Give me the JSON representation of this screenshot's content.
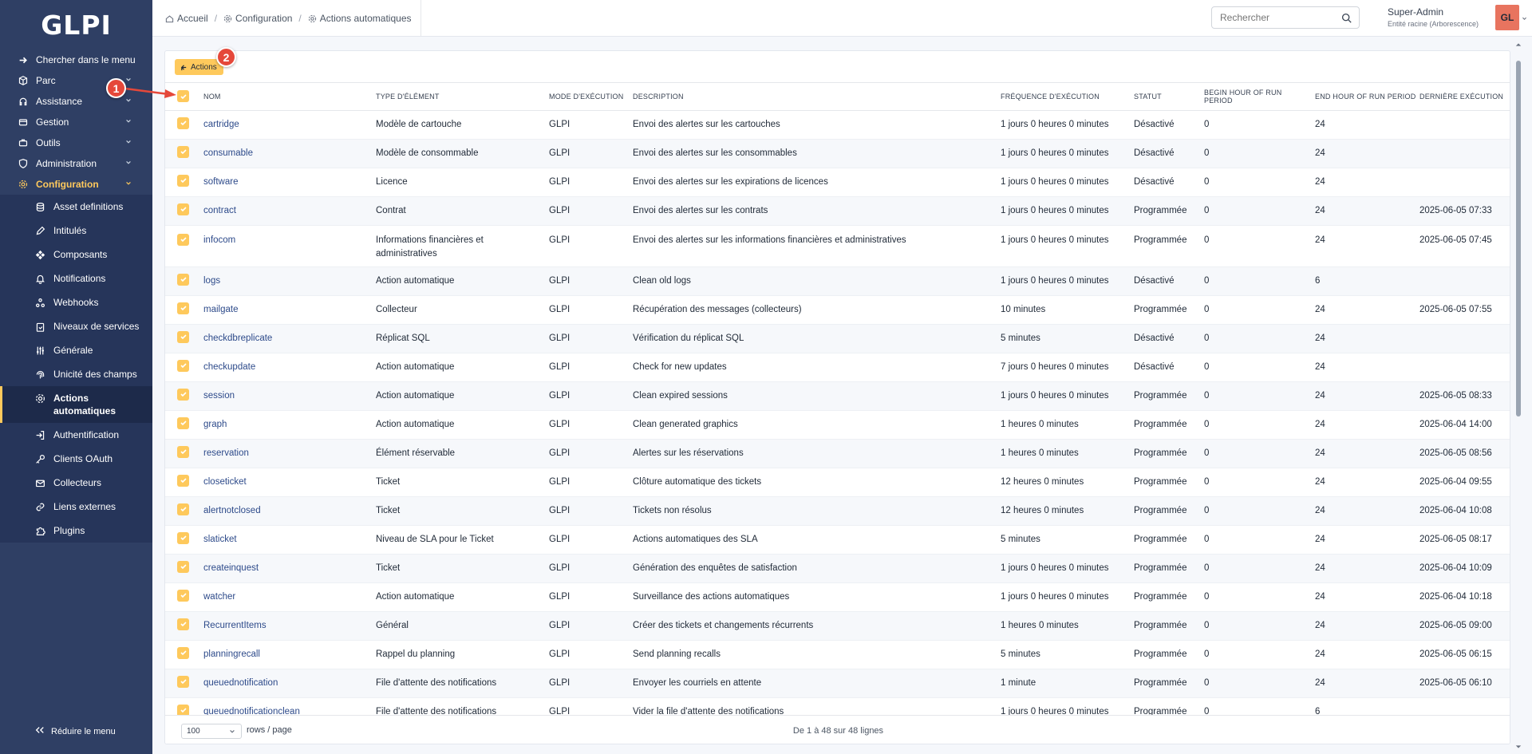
{
  "sidebar": {
    "logo": "GLPI",
    "search_menu": "Chercher dans le menu",
    "items": [
      {
        "label": "Parc"
      },
      {
        "label": "Assistance"
      },
      {
        "label": "Gestion"
      },
      {
        "label": "Outils"
      },
      {
        "label": "Administration"
      },
      {
        "label": "Configuration"
      }
    ],
    "subitems": [
      {
        "label": "Asset definitions"
      },
      {
        "label": "Intitulés"
      },
      {
        "label": "Composants"
      },
      {
        "label": "Notifications"
      },
      {
        "label": "Webhooks"
      },
      {
        "label": "Niveaux de services"
      },
      {
        "label": "Générale"
      },
      {
        "label": "Unicité des champs"
      },
      {
        "label": "Actions automatiques"
      },
      {
        "label": "Authentification"
      },
      {
        "label": "Clients OAuth"
      },
      {
        "label": "Collecteurs"
      },
      {
        "label": "Liens externes"
      },
      {
        "label": "Plugins"
      }
    ],
    "collapse_label": "Réduire le menu"
  },
  "header": {
    "breadcrumb": [
      "Accueil",
      "Configuration",
      "Actions automatiques"
    ],
    "search_placeholder": "Rechercher",
    "user_name": "Super-Admin",
    "user_entity": "Entité racine (Arborescence)",
    "avatar_initials": "GL"
  },
  "toolbar": {
    "actions_label": "Actions"
  },
  "annotations": {
    "badge1": "1",
    "badge2": "2"
  },
  "table": {
    "columns": [
      "NOM",
      "TYPE D'ÉLÉMENT",
      "MODE D'EXÉCUTION",
      "DESCRIPTION",
      "FRÉQUENCE D'EXÉCUTION",
      "STATUT",
      "BEGIN HOUR OF RUN PERIOD",
      "END HOUR OF RUN PERIOD",
      "DERNIÈRE EXÉCUTION"
    ],
    "rows": [
      [
        "cartridge",
        "Modèle de cartouche",
        "GLPI",
        "Envoi des alertes sur les cartouches",
        "1 jours 0 heures 0 minutes",
        "Désactivé",
        "0",
        "24",
        ""
      ],
      [
        "consumable",
        "Modèle de consommable",
        "GLPI",
        "Envoi des alertes sur les consommables",
        "1 jours 0 heures 0 minutes",
        "Désactivé",
        "0",
        "24",
        ""
      ],
      [
        "software",
        "Licence",
        "GLPI",
        "Envoi des alertes sur les expirations de licences",
        "1 jours 0 heures 0 minutes",
        "Désactivé",
        "0",
        "24",
        ""
      ],
      [
        "contract",
        "Contrat",
        "GLPI",
        "Envoi des alertes sur les contrats",
        "1 jours 0 heures 0 minutes",
        "Programmée",
        "0",
        "24",
        "2025-06-05 07:33"
      ],
      [
        "infocom",
        "Informations financières et administratives",
        "GLPI",
        "Envoi des alertes sur les informations financières et administratives",
        "1 jours 0 heures 0 minutes",
        "Programmée",
        "0",
        "24",
        "2025-06-05 07:45"
      ],
      [
        "logs",
        "Action automatique",
        "GLPI",
        "Clean old logs",
        "1 jours 0 heures 0 minutes",
        "Désactivé",
        "0",
        "6",
        ""
      ],
      [
        "mailgate",
        "Collecteur",
        "GLPI",
        "Récupération des messages (collecteurs)",
        "10 minutes",
        "Programmée",
        "0",
        "24",
        "2025-06-05 07:55"
      ],
      [
        "checkdbreplicate",
        "Réplicat SQL",
        "GLPI",
        "Vérification du réplicat SQL",
        "5 minutes",
        "Désactivé",
        "0",
        "24",
        ""
      ],
      [
        "checkupdate",
        "Action automatique",
        "GLPI",
        "Check for new updates",
        "7 jours 0 heures 0 minutes",
        "Désactivé",
        "0",
        "24",
        ""
      ],
      [
        "session",
        "Action automatique",
        "GLPI",
        "Clean expired sessions",
        "1 jours 0 heures 0 minutes",
        "Programmée",
        "0",
        "24",
        "2025-06-05 08:33"
      ],
      [
        "graph",
        "Action automatique",
        "GLPI",
        "Clean generated graphics",
        "1 heures 0 minutes",
        "Programmée",
        "0",
        "24",
        "2025-06-04 14:00"
      ],
      [
        "reservation",
        "Élément réservable",
        "GLPI",
        "Alertes sur les réservations",
        "1 heures 0 minutes",
        "Programmée",
        "0",
        "24",
        "2025-06-05 08:56"
      ],
      [
        "closeticket",
        "Ticket",
        "GLPI",
        "Clôture automatique des tickets",
        "12 heures 0 minutes",
        "Programmée",
        "0",
        "24",
        "2025-06-04 09:55"
      ],
      [
        "alertnotclosed",
        "Ticket",
        "GLPI",
        "Tickets non résolus",
        "12 heures 0 minutes",
        "Programmée",
        "0",
        "24",
        "2025-06-04 10:08"
      ],
      [
        "slaticket",
        "Niveau de SLA pour le Ticket",
        "GLPI",
        "Actions automatiques des SLA",
        "5 minutes",
        "Programmée",
        "0",
        "24",
        "2025-06-05 08:17"
      ],
      [
        "createinquest",
        "Ticket",
        "GLPI",
        "Génération des enquêtes de satisfaction",
        "1 jours 0 heures 0 minutes",
        "Programmée",
        "0",
        "24",
        "2025-06-04 10:09"
      ],
      [
        "watcher",
        "Action automatique",
        "GLPI",
        "Surveillance des actions automatiques",
        "1 jours 0 heures 0 minutes",
        "Programmée",
        "0",
        "24",
        "2025-06-04 10:18"
      ],
      [
        "RecurrentItems",
        "Général",
        "GLPI",
        "Créer des tickets et changements récurrents",
        "1 heures 0 minutes",
        "Programmée",
        "0",
        "24",
        "2025-06-05 09:00"
      ],
      [
        "planningrecall",
        "Rappel du planning",
        "GLPI",
        "Send planning recalls",
        "5 minutes",
        "Programmée",
        "0",
        "24",
        "2025-06-05 06:15"
      ],
      [
        "queuednotification",
        "File d'attente des notifications",
        "GLPI",
        "Envoyer les courriels en attente",
        "1 minute",
        "Programmée",
        "0",
        "24",
        "2025-06-05 06:10"
      ],
      [
        "queuednotificationclean",
        "File d'attente des notifications",
        "GLPI",
        "Vider la file d'attente des notifications",
        "1 jours 0 heures 0 minutes",
        "Programmée",
        "0",
        "6",
        ""
      ]
    ]
  },
  "footer": {
    "page_size": "100",
    "rows_label": "rows / page",
    "page_info": "De 1 à 48 sur 48 lignes"
  },
  "colors": {
    "sidebar_bg": "#2f3f64",
    "accent": "#fec95c",
    "annotation": "#e5483a",
    "avatar": "#e8745f"
  }
}
